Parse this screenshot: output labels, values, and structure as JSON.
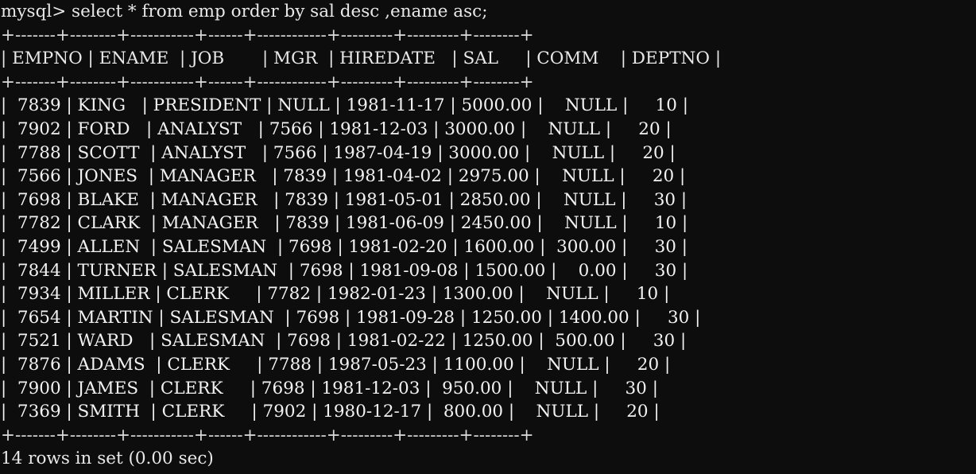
{
  "terminal": {
    "prompt": "mysql> ",
    "command": "select * from emp order by sal desc ,ename asc;",
    "prompt_line": "mysql> select * from emp order by sal desc ,ename asc;",
    "footer": "14 rows in set (0.00 sec)",
    "row_count": 14,
    "elapsed": "0.00 sec",
    "background_color": "#0d0d0d",
    "foreground_color": "#e8e8e8"
  },
  "table": {
    "separator": "+-------+--------+-----------+------+------------+---------+---------+--------+",
    "header_line": "| EMPNO | ENAME  | JOB       | MGR  | HIREDATE   | SAL     | COMM    | DEPTNO |",
    "columns": [
      {
        "name": "EMPNO",
        "width": 5,
        "align": "right"
      },
      {
        "name": "ENAME",
        "width": 6,
        "align": "left"
      },
      {
        "name": "JOB",
        "width": 9,
        "align": "left"
      },
      {
        "name": "MGR",
        "width": 4,
        "align": "right"
      },
      {
        "name": "HIREDATE",
        "width": 10,
        "align": "left"
      },
      {
        "name": "SAL",
        "width": 7,
        "align": "right"
      },
      {
        "name": "COMM",
        "width": 7,
        "align": "right"
      },
      {
        "name": "DEPTNO",
        "width": 6,
        "align": "right"
      }
    ],
    "rows": [
      {
        "EMPNO": "7839",
        "ENAME": "KING",
        "JOB": "PRESIDENT",
        "MGR": "NULL",
        "HIREDATE": "1981-11-17",
        "SAL": "5000.00",
        "COMM": "NULL",
        "DEPTNO": "10"
      },
      {
        "EMPNO": "7902",
        "ENAME": "FORD",
        "JOB": "ANALYST",
        "MGR": "7566",
        "HIREDATE": "1981-12-03",
        "SAL": "3000.00",
        "COMM": "NULL",
        "DEPTNO": "20"
      },
      {
        "EMPNO": "7788",
        "ENAME": "SCOTT",
        "JOB": "ANALYST",
        "MGR": "7566",
        "HIREDATE": "1987-04-19",
        "SAL": "3000.00",
        "COMM": "NULL",
        "DEPTNO": "20"
      },
      {
        "EMPNO": "7566",
        "ENAME": "JONES",
        "JOB": "MANAGER",
        "MGR": "7839",
        "HIREDATE": "1981-04-02",
        "SAL": "2975.00",
        "COMM": "NULL",
        "DEPTNO": "20"
      },
      {
        "EMPNO": "7698",
        "ENAME": "BLAKE",
        "JOB": "MANAGER",
        "MGR": "7839",
        "HIREDATE": "1981-05-01",
        "SAL": "2850.00",
        "COMM": "NULL",
        "DEPTNO": "30"
      },
      {
        "EMPNO": "7782",
        "ENAME": "CLARK",
        "JOB": "MANAGER",
        "MGR": "7839",
        "HIREDATE": "1981-06-09",
        "SAL": "2450.00",
        "COMM": "NULL",
        "DEPTNO": "10"
      },
      {
        "EMPNO": "7499",
        "ENAME": "ALLEN",
        "JOB": "SALESMAN",
        "MGR": "7698",
        "HIREDATE": "1981-02-20",
        "SAL": "1600.00",
        "COMM": "300.00",
        "DEPTNO": "30"
      },
      {
        "EMPNO": "7844",
        "ENAME": "TURNER",
        "JOB": "SALESMAN",
        "MGR": "7698",
        "HIREDATE": "1981-09-08",
        "SAL": "1500.00",
        "COMM": "0.00",
        "DEPTNO": "30"
      },
      {
        "EMPNO": "7934",
        "ENAME": "MILLER",
        "JOB": "CLERK",
        "MGR": "7782",
        "HIREDATE": "1982-01-23",
        "SAL": "1300.00",
        "COMM": "NULL",
        "DEPTNO": "10"
      },
      {
        "EMPNO": "7654",
        "ENAME": "MARTIN",
        "JOB": "SALESMAN",
        "MGR": "7698",
        "HIREDATE": "1981-09-28",
        "SAL": "1250.00",
        "COMM": "1400.00",
        "DEPTNO": "30"
      },
      {
        "EMPNO": "7521",
        "ENAME": "WARD",
        "JOB": "SALESMAN",
        "MGR": "7698",
        "HIREDATE": "1981-02-22",
        "SAL": "1250.00",
        "COMM": "500.00",
        "DEPTNO": "30"
      },
      {
        "EMPNO": "7876",
        "ENAME": "ADAMS",
        "JOB": "CLERK",
        "MGR": "7788",
        "HIREDATE": "1987-05-23",
        "SAL": "1100.00",
        "COMM": "NULL",
        "DEPTNO": "20"
      },
      {
        "EMPNO": "7900",
        "ENAME": "JAMES",
        "JOB": "CLERK",
        "MGR": "7698",
        "HIREDATE": "1981-12-03",
        "SAL": "950.00",
        "COMM": "NULL",
        "DEPTNO": "30"
      },
      {
        "EMPNO": "7369",
        "ENAME": "SMITH",
        "JOB": "CLERK",
        "MGR": "7902",
        "HIREDATE": "1980-12-17",
        "SAL": "800.00",
        "COMM": "NULL",
        "DEPTNO": "20"
      }
    ]
  }
}
